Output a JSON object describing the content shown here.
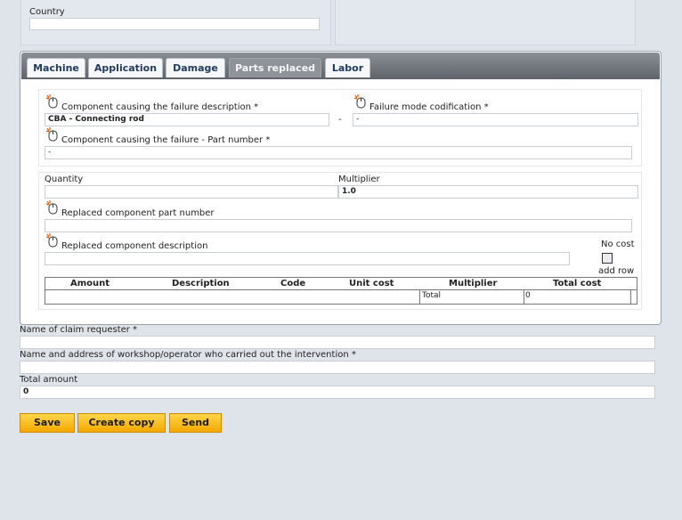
{
  "top_section": {
    "country_label": "Country",
    "country_value": ""
  },
  "tabs": [
    {
      "label": "Machine",
      "active": false
    },
    {
      "label": "Application",
      "active": false
    },
    {
      "label": "Damage",
      "active": false
    },
    {
      "label": "Parts replaced",
      "active": true
    },
    {
      "label": "Labor",
      "active": false
    }
  ],
  "parts": {
    "component_desc_label": "Component causing the failure description *",
    "component_desc_value": "CBA - Connecting rod",
    "separator": "-",
    "failure_mode_label": "Failure mode codification *",
    "failure_mode_value": "-",
    "part_number_label": "Component causing the failure - Part number *",
    "part_number_value": "-"
  },
  "replaced": {
    "quantity_label": "Quantity",
    "quantity_value": "",
    "multiplier_label": "Multiplier",
    "multiplier_value": "1.0",
    "part_number_label": "Replaced component part number",
    "part_number_value": "",
    "description_label": "Replaced component description",
    "description_value": "",
    "no_cost_label": "No cost",
    "add_row_label": "add row",
    "no_cost_checked": false
  },
  "cost_table": {
    "headers": [
      "Amount",
      "Description",
      "Code",
      "Unit cost",
      "Multiplier",
      "Total cost"
    ],
    "total_label": "Total",
    "total_value": "0"
  },
  "footer_fields": {
    "requester_label": "Name of claim requester *",
    "requester_value": "",
    "workshop_label": "Name and address of workshop/operator who carried out the intervention *",
    "workshop_value": "",
    "total_amount_label": "Total amount",
    "total_amount_value": "0"
  },
  "buttons": {
    "save": "Save",
    "copy": "Create copy",
    "send": "Send"
  },
  "colors": {
    "button_yellow": "#f4a900",
    "tabbar_gray": "#6f747a",
    "tab_text": "#223a5e"
  },
  "icons": [
    "help-icon"
  ]
}
